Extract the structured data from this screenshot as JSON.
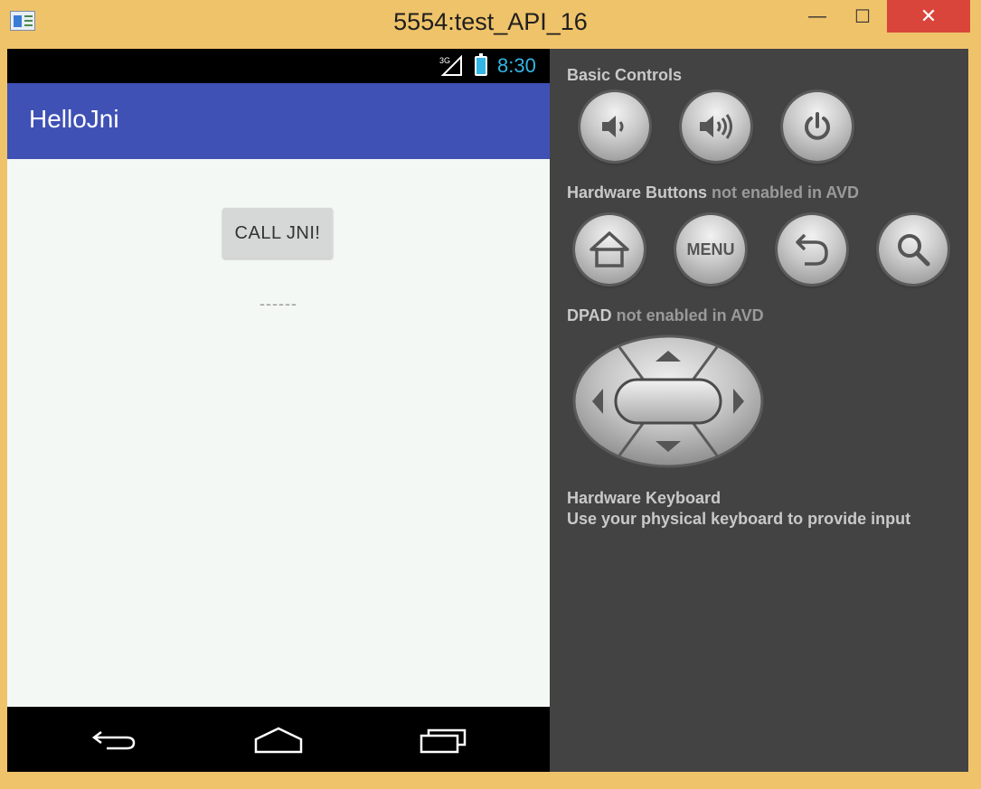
{
  "window": {
    "title": "5554:test_API_16",
    "minimize_glyph": "—",
    "maximize_glyph": "☐",
    "close_glyph": "✕"
  },
  "device": {
    "status_bar": {
      "network": "3G",
      "time": "8:30",
      "accent_color": "#33b5e5"
    },
    "app_bar": {
      "title": "HelloJni",
      "color": "#3f51b5"
    },
    "content": {
      "call_button_label": "CALL JNI!",
      "result_text": "------"
    },
    "nav_bar": {
      "back_icon": "back-icon",
      "home_icon": "home-icon",
      "recents_icon": "recents-icon"
    }
  },
  "controls": {
    "basic_controls_label": "Basic Controls",
    "basic_buttons": [
      "volume-down-icon",
      "volume-up-icon",
      "power-icon"
    ],
    "hardware_buttons_label": "Hardware Buttons",
    "hardware_buttons_note": " not enabled in AVD",
    "hardware_buttons": [
      "home-icon",
      "menu",
      "back-icon",
      "search-icon"
    ],
    "menu_button_label": "MENU",
    "dpad_label": "DPAD",
    "dpad_note": " not enabled in AVD",
    "keyboard_label": "Hardware Keyboard",
    "keyboard_note": "Use your physical keyboard to provide input"
  }
}
